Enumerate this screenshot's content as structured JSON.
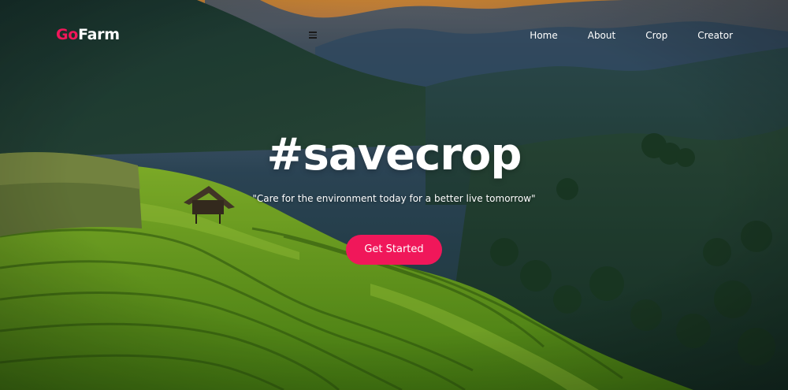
{
  "brand": {
    "logo_accent": "Go",
    "logo_rest": "Farm",
    "accent_color": "#f0175a"
  },
  "nav": {
    "items": [
      {
        "label": "Home"
      },
      {
        "label": "About"
      },
      {
        "label": "Crop"
      },
      {
        "label": "Creator"
      }
    ]
  },
  "hero": {
    "headline": "#savecrop",
    "tagline": "\"Care for the environment today for a better live tomorrow\"",
    "cta_label": "Get Started"
  },
  "icons": {
    "menu": "hamburger-menu-icon"
  }
}
